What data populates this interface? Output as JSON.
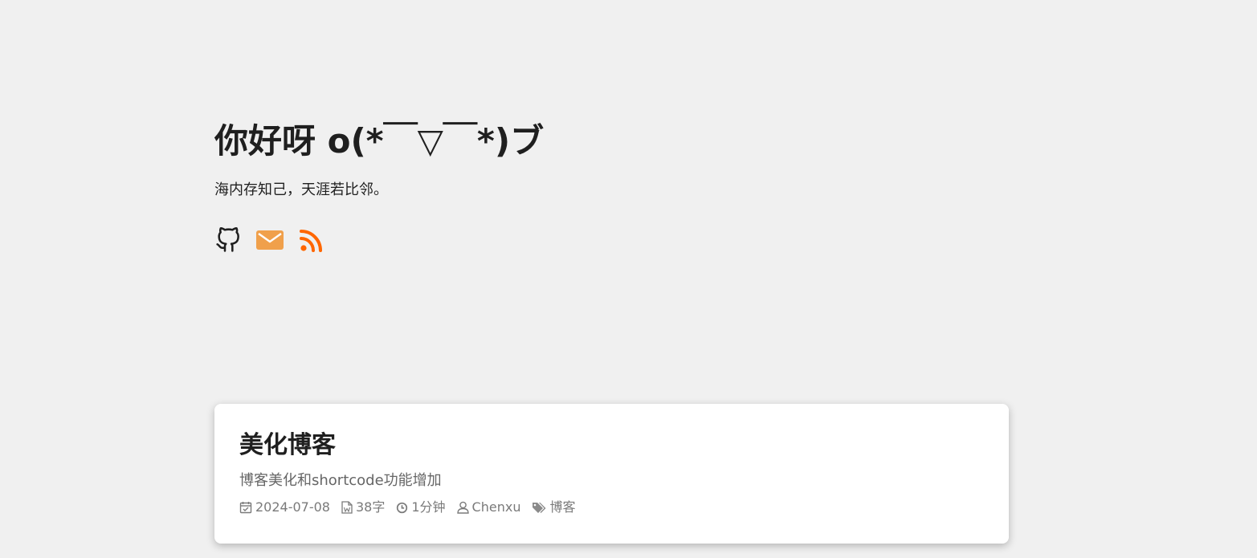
{
  "home": {
    "title": "你好呀 o(*￣▽￣*)ブ",
    "subtitle": "海内存知己，天涯若比邻。",
    "social": [
      {
        "icon": "github-icon",
        "color": "#1f1f1f"
      },
      {
        "icon": "email-icon",
        "color": "#f0a04b"
      },
      {
        "icon": "rss-icon",
        "color": "#ff6600"
      }
    ]
  },
  "post": {
    "title": "美化博客",
    "summary": "博客美化和shortcode功能增加",
    "meta": {
      "date": "2024-07-08",
      "words": "38字",
      "reading_time": "1分钟",
      "author": "Chenxu",
      "tag": "博客"
    }
  },
  "colors": {
    "background": "#f0f0f0",
    "card": "#ffffff",
    "text": "#1f1f1f",
    "muted": "#7a7a7a"
  }
}
